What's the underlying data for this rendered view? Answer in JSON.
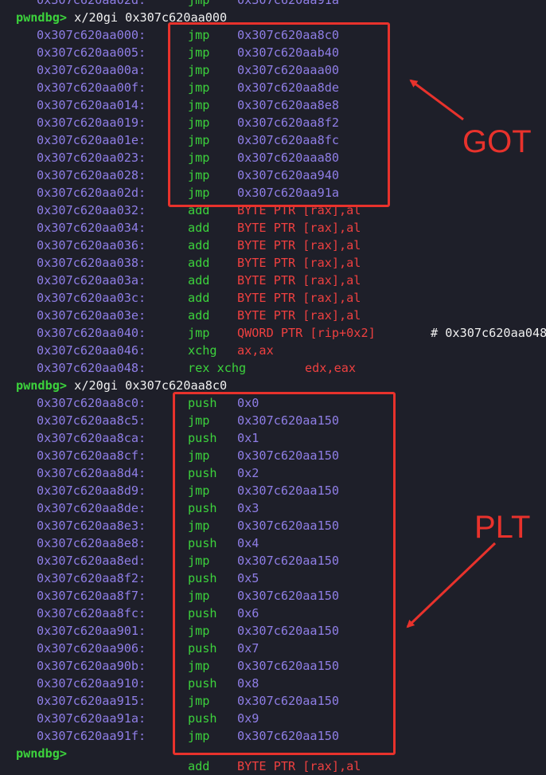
{
  "terminal": {
    "partial_top_line": {
      "address": "0x307c620aa02d:",
      "mnemonic": "jmp",
      "operands": "0x307c620aa91a"
    },
    "sections": [
      {
        "prompt": "pwndbg>",
        "command": "x/20gi 0x307c620aa000",
        "rows": [
          {
            "address": "0x307c620aa000:",
            "mnemonic": "jmp",
            "operands": "0x307c620aa8c0"
          },
          {
            "address": "0x307c620aa005:",
            "mnemonic": "jmp",
            "operands": "0x307c620aab40"
          },
          {
            "address": "0x307c620aa00a:",
            "mnemonic": "jmp",
            "operands": "0x307c620aaa00"
          },
          {
            "address": "0x307c620aa00f:",
            "mnemonic": "jmp",
            "operands": "0x307c620aa8de"
          },
          {
            "address": "0x307c620aa014:",
            "mnemonic": "jmp",
            "operands": "0x307c620aa8e8"
          },
          {
            "address": "0x307c620aa019:",
            "mnemonic": "jmp",
            "operands": "0x307c620aa8f2"
          },
          {
            "address": "0x307c620aa01e:",
            "mnemonic": "jmp",
            "operands": "0x307c620aa8fc"
          },
          {
            "address": "0x307c620aa023:",
            "mnemonic": "jmp",
            "operands": "0x307c620aaa80"
          },
          {
            "address": "0x307c620aa028:",
            "mnemonic": "jmp",
            "operands": "0x307c620aa940"
          },
          {
            "address": "0x307c620aa02d:",
            "mnemonic": "jmp",
            "operands": "0x307c620aa91a"
          },
          {
            "address": "0x307c620aa032:",
            "mnemonic": "add",
            "operands": "BYTE PTR [rax],al",
            "style": "mem"
          },
          {
            "address": "0x307c620aa034:",
            "mnemonic": "add",
            "operands": "BYTE PTR [rax],al",
            "style": "mem"
          },
          {
            "address": "0x307c620aa036:",
            "mnemonic": "add",
            "operands": "BYTE PTR [rax],al",
            "style": "mem"
          },
          {
            "address": "0x307c620aa038:",
            "mnemonic": "add",
            "operands": "BYTE PTR [rax],al",
            "style": "mem"
          },
          {
            "address": "0x307c620aa03a:",
            "mnemonic": "add",
            "operands": "BYTE PTR [rax],al",
            "style": "mem"
          },
          {
            "address": "0x307c620aa03c:",
            "mnemonic": "add",
            "operands": "BYTE PTR [rax],al",
            "style": "mem"
          },
          {
            "address": "0x307c620aa03e:",
            "mnemonic": "add",
            "operands": "BYTE PTR [rax],al",
            "style": "mem"
          },
          {
            "address": "0x307c620aa040:",
            "mnemonic": "jmp",
            "operands": "QWORD PTR [rip+0x2]",
            "style": "mem",
            "comment": "# 0x307c620aa048"
          },
          {
            "address": "0x307c620aa046:",
            "mnemonic": "xchg",
            "operands": "ax,ax",
            "style": "reg"
          },
          {
            "address": "0x307c620aa048:",
            "mnemonic": "rex xchg",
            "operands": "edx,eax",
            "style": "reg"
          }
        ]
      },
      {
        "prompt": "pwndbg>",
        "command": "x/20gi 0x307c620aa8c0",
        "rows": [
          {
            "address": "0x307c620aa8c0:",
            "mnemonic": "push",
            "operands": "0x0"
          },
          {
            "address": "0x307c620aa8c5:",
            "mnemonic": "jmp",
            "operands": "0x307c620aa150"
          },
          {
            "address": "0x307c620aa8ca:",
            "mnemonic": "push",
            "operands": "0x1"
          },
          {
            "address": "0x307c620aa8cf:",
            "mnemonic": "jmp",
            "operands": "0x307c620aa150"
          },
          {
            "address": "0x307c620aa8d4:",
            "mnemonic": "push",
            "operands": "0x2"
          },
          {
            "address": "0x307c620aa8d9:",
            "mnemonic": "jmp",
            "operands": "0x307c620aa150"
          },
          {
            "address": "0x307c620aa8de:",
            "mnemonic": "push",
            "operands": "0x3"
          },
          {
            "address": "0x307c620aa8e3:",
            "mnemonic": "jmp",
            "operands": "0x307c620aa150"
          },
          {
            "address": "0x307c620aa8e8:",
            "mnemonic": "push",
            "operands": "0x4"
          },
          {
            "address": "0x307c620aa8ed:",
            "mnemonic": "jmp",
            "operands": "0x307c620aa150"
          },
          {
            "address": "0x307c620aa8f2:",
            "mnemonic": "push",
            "operands": "0x5"
          },
          {
            "address": "0x307c620aa8f7:",
            "mnemonic": "jmp",
            "operands": "0x307c620aa150"
          },
          {
            "address": "0x307c620aa8fc:",
            "mnemonic": "push",
            "operands": "0x6"
          },
          {
            "address": "0x307c620aa901:",
            "mnemonic": "jmp",
            "operands": "0x307c620aa150"
          },
          {
            "address": "0x307c620aa906:",
            "mnemonic": "push",
            "operands": "0x7"
          },
          {
            "address": "0x307c620aa90b:",
            "mnemonic": "jmp",
            "operands": "0x307c620aa150"
          },
          {
            "address": "0x307c620aa910:",
            "mnemonic": "push",
            "operands": "0x8"
          },
          {
            "address": "0x307c620aa915:",
            "mnemonic": "jmp",
            "operands": "0x307c620aa150"
          },
          {
            "address": "0x307c620aa91a:",
            "mnemonic": "push",
            "operands": "0x9"
          },
          {
            "address": "0x307c620aa91f:",
            "mnemonic": "jmp",
            "operands": "0x307c620aa150"
          }
        ]
      }
    ],
    "final_prompt": "pwndbg>",
    "partial_bottom_line": {
      "mnemonic": "add",
      "operands": "BYTE PTR [rax],al"
    }
  },
  "annotations": {
    "got_label": "GOT",
    "plt_label": "PLT",
    "color": "#e8322c"
  },
  "colors": {
    "background": "#1e1f29",
    "address": "#8f7ee6",
    "mnemonic": "#3cd23c",
    "memory_operand": "#ee4040",
    "text": "#f0f0f0"
  }
}
